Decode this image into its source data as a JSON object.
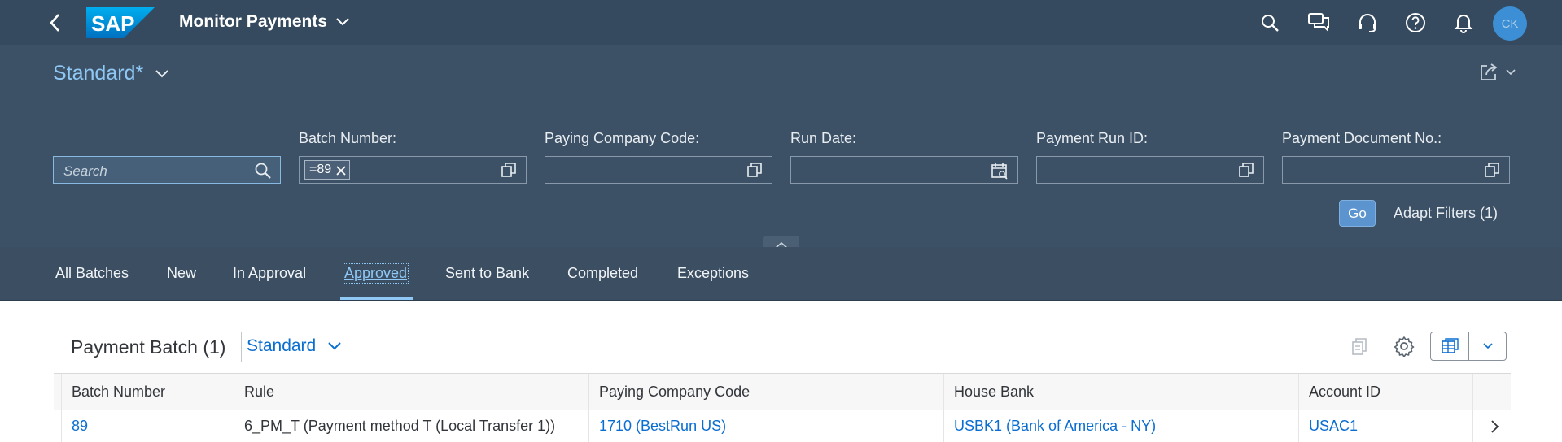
{
  "shell": {
    "app_title": "Monitor Payments",
    "logo_text": "SAP",
    "avatar_initials": "CK"
  },
  "header": {
    "variant_name": "Standard",
    "variant_modified": "*",
    "search_placeholder": "Search",
    "filters": [
      {
        "label": "Batch Number:",
        "tokens": [
          "=89"
        ]
      },
      {
        "label": "Paying Company Code:",
        "tokens": []
      },
      {
        "label": "Run Date:",
        "tokens": []
      },
      {
        "label": "Payment Run ID:",
        "tokens": []
      },
      {
        "label": "Payment Document No.:",
        "tokens": []
      }
    ],
    "go_label": "Go",
    "adapt_filters_label": "Adapt Filters (1)"
  },
  "tabs": [
    {
      "label": "All Batches",
      "active": false
    },
    {
      "label": "New",
      "active": false
    },
    {
      "label": "In Approval",
      "active": false
    },
    {
      "label": "Approved",
      "active": true
    },
    {
      "label": "Sent to Bank",
      "active": false
    },
    {
      "label": "Completed",
      "active": false
    },
    {
      "label": "Exceptions",
      "active": false
    }
  ],
  "table": {
    "title": "Payment Batch (1)",
    "variant": "Standard",
    "columns": [
      "Batch Number",
      "Rule",
      "Paying Company Code",
      "House Bank",
      "Account ID"
    ],
    "rows": [
      [
        "89",
        "6_PM_T (Payment method T (Local Transfer 1))",
        "1710 (BestRun US)",
        "USBK1 (Bank of America - NY)",
        "USAC1"
      ]
    ]
  },
  "colors": {
    "shell_bg": "#354a5f",
    "header_bg": "#3d5166",
    "accent": "#8fc8f5",
    "link": "#0a6ed1"
  }
}
